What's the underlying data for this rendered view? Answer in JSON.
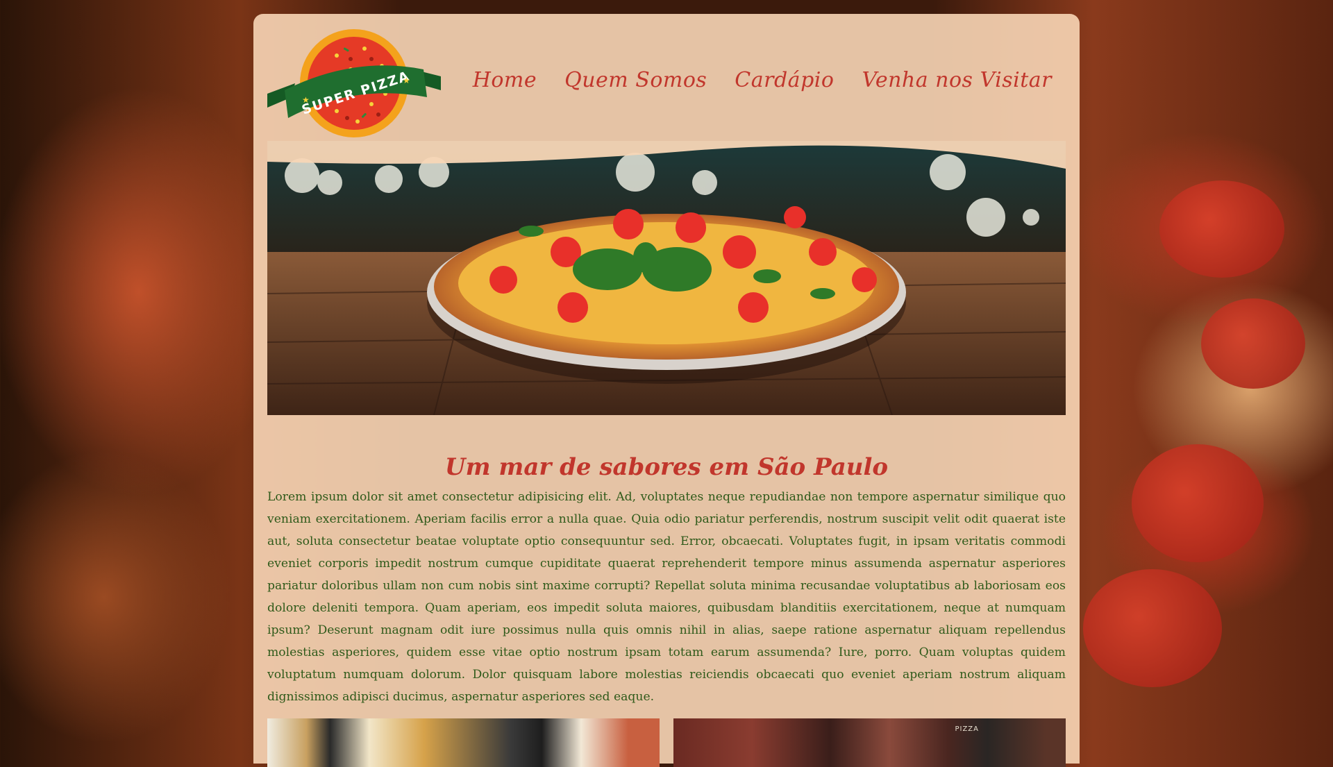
{
  "logo": {
    "text": "SUPER PIZZA"
  },
  "nav": [
    {
      "label": "Home"
    },
    {
      "label": "Quem Somos"
    },
    {
      "label": "Cardápio"
    },
    {
      "label": "Venha nos Visitar"
    }
  ],
  "main": {
    "heading": "Um mar de sabores em São Paulo",
    "paragraph": "Lorem ipsum dolor sit amet consectetur adipisicing elit. Ad, voluptates neque repudiandae non tempore aspernatur similique quo veniam exercitationem. Aperiam facilis error a nulla quae. Quia odio pariatur perferendis, nostrum suscipit velit odit quaerat iste aut, soluta consectetur beatae voluptate optio consequuntur sed. Error, obcaecati. Voluptates fugit, in ipsam veritatis commodi eveniet corporis impedit nostrum cumque cupiditate quaerat reprehenderit tempore minus assumenda aspernatur asperiores pariatur doloribus ullam non cum nobis sint maxime corrupti? Repellat soluta minima recusandae voluptatibus ab laboriosam eos dolore deleniti tempora. Quam aperiam, eos impedit soluta maiores, quibusdam blanditiis exercitationem, neque at numquam ipsum? Deserunt magnam odit iure possimus nulla quis omnis nihil in alias, saepe ratione aspernatur aliquam repellendus molestias asperiores, quidem esse vitae optio nostrum ipsam totam earum assumenda? Iure, porro. Quam voluptas quidem voluptatum numquam dolorum. Dolor quisquam labore molestias reiciendis obcaecati quo eveniet aperiam nostrum aliquam dignissimos adipisci ducimus, aspernatur asperiores sed eaque."
  },
  "gallery": {
    "sign_text": "PIZZA"
  },
  "colors": {
    "accent": "#c1362c",
    "text": "#2f5a1a",
    "panel": "#f8d6b6",
    "logo_ribbon": "#1f6e2f",
    "logo_disc": "#e53a26",
    "logo_ring": "#f4a21c"
  }
}
